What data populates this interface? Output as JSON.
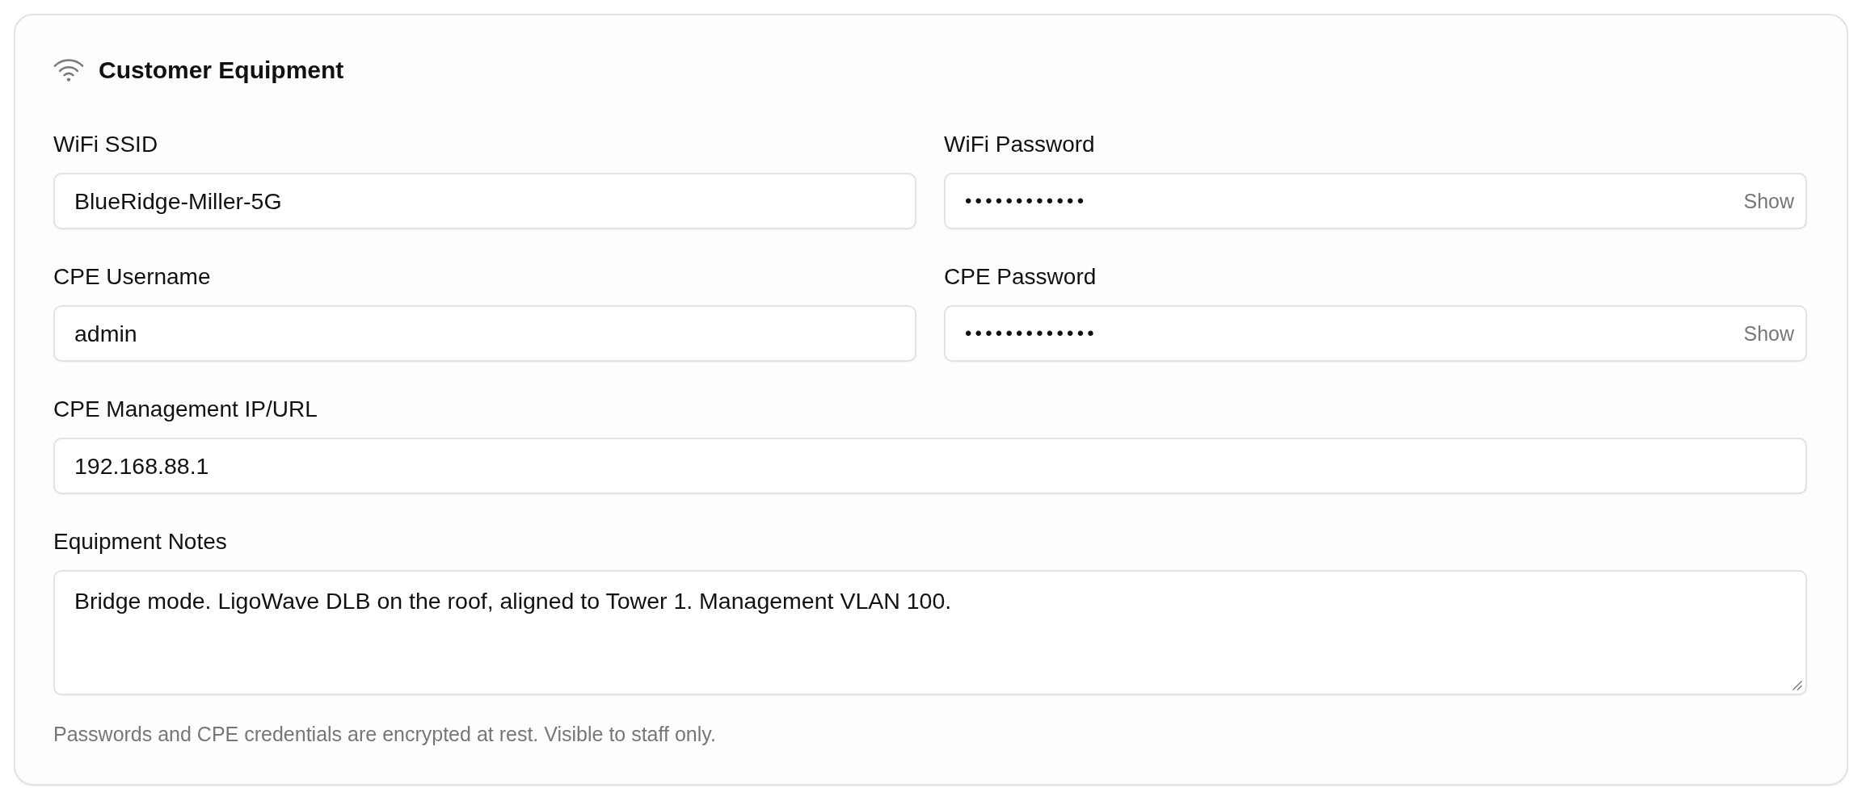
{
  "section": {
    "title": "Customer Equipment"
  },
  "rows": [
    [
      {
        "kind": "text",
        "label": "WiFi SSID",
        "value": "BlueRidge-Miller-5G"
      },
      {
        "kind": "password",
        "label": "WiFi Password",
        "value": "••••••••••••",
        "toggle": "Show"
      }
    ],
    [
      {
        "kind": "text",
        "label": "CPE Username",
        "value": "admin"
      },
      {
        "kind": "password",
        "label": "CPE Password",
        "value": "•••••••••••••",
        "toggle": "Show"
      }
    ],
    [
      {
        "kind": "text",
        "label": "CPE Management IP/URL",
        "value": "192.168.88.1"
      }
    ],
    [
      {
        "kind": "textarea",
        "label": "Equipment Notes",
        "value": "Bridge mode. LigoWave DLB on the roof, aligned to Tower 1. Management VLAN 100."
      }
    ]
  ],
  "note": "Passwords and CPE credentials are encrypted at rest. Visible to staff only."
}
